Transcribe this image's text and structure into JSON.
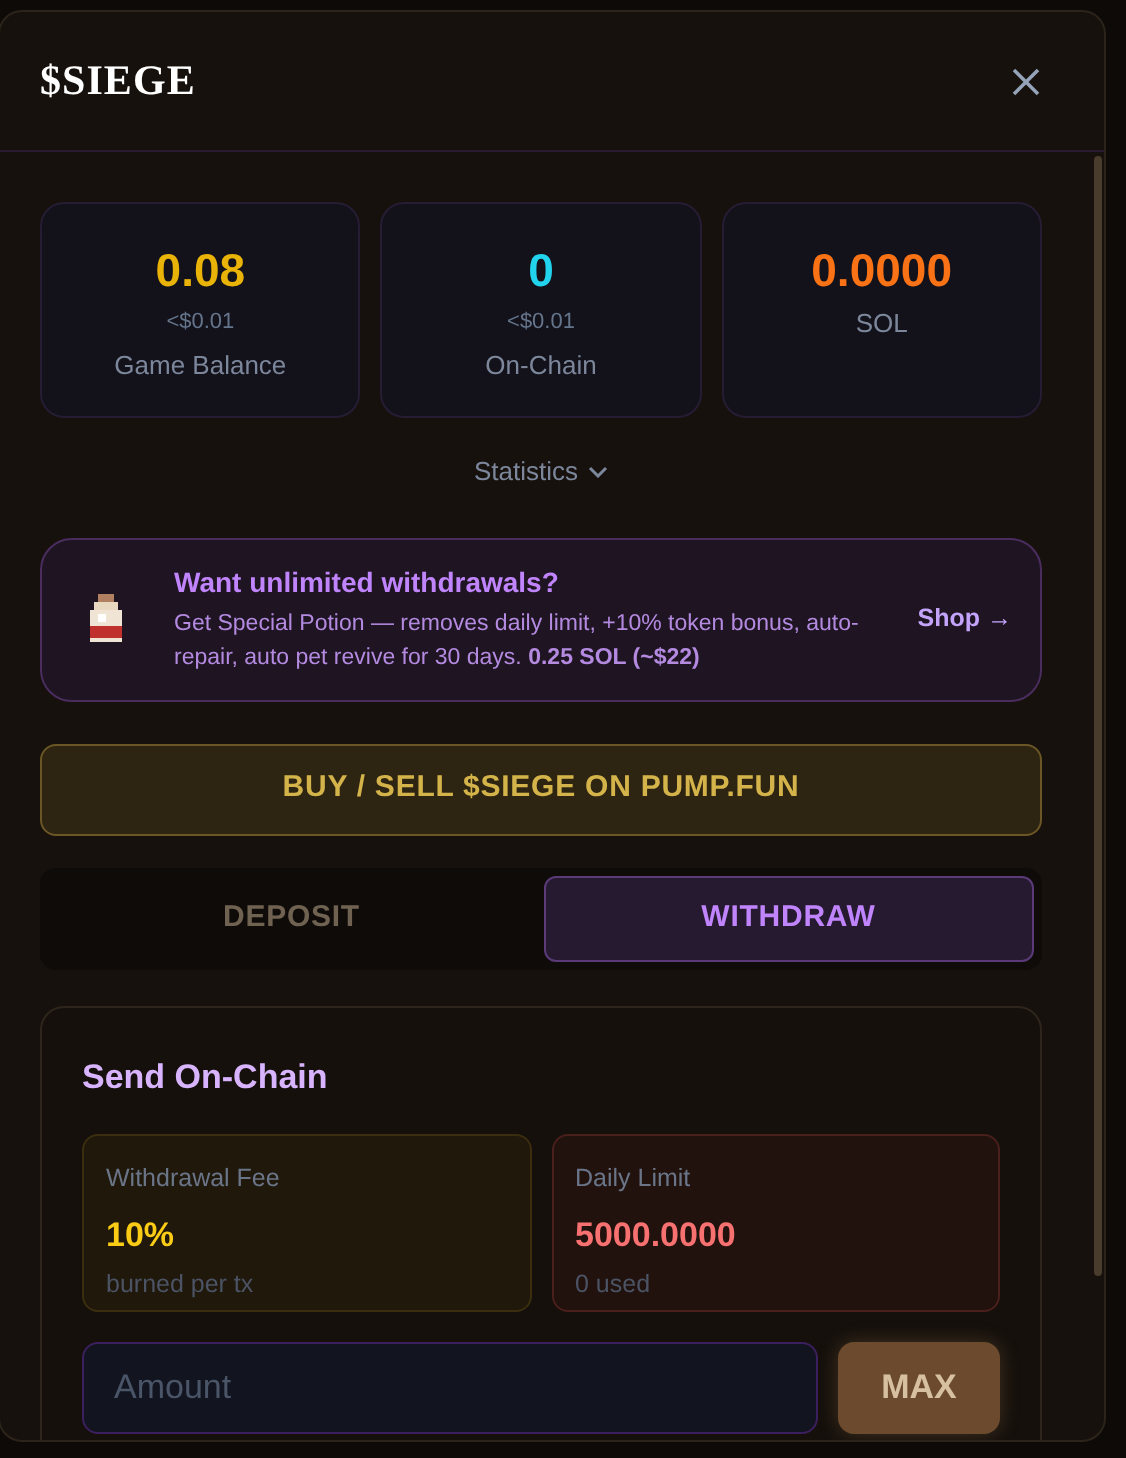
{
  "dialog": {
    "title": "$SIEGE"
  },
  "stats": [
    {
      "value": "0.08",
      "color": "#eab308",
      "usd": "<$0.01",
      "label": "Game Balance"
    },
    {
      "value": "0",
      "color": "#22d3ee",
      "usd": "<$0.01",
      "label": "On-Chain"
    },
    {
      "value": "0.0000",
      "color": "#f97316",
      "label": "SOL"
    }
  ],
  "statistics_toggle": {
    "label": "Statistics",
    "expanded": false
  },
  "promo": {
    "title": "Want unlimited withdrawals?",
    "text": "Get Special Potion — removes daily limit, +10% token bonus, auto-repair, auto pet revive for 30 days. **0.25 SOL (~$22)**",
    "link": "Shop →"
  },
  "buy_button": "BUY / SELL $SIEGE ON PUMP.FUN",
  "tabs": [
    {
      "label": "DEPOSIT",
      "selected": false
    },
    {
      "label": "WITHDRAW",
      "selected": true
    }
  ],
  "send": {
    "title": "Send On-Chain",
    "info": [
      {
        "kind": "fee",
        "label": "Withdrawal Fee",
        "value": "10%",
        "note": "burned per tx"
      },
      {
        "kind": "limit",
        "label": "Daily Limit",
        "value": "5000.0000",
        "note": "0 used"
      }
    ],
    "amount": {
      "placeholder": "Amount"
    },
    "max_button": "MAX"
  }
}
